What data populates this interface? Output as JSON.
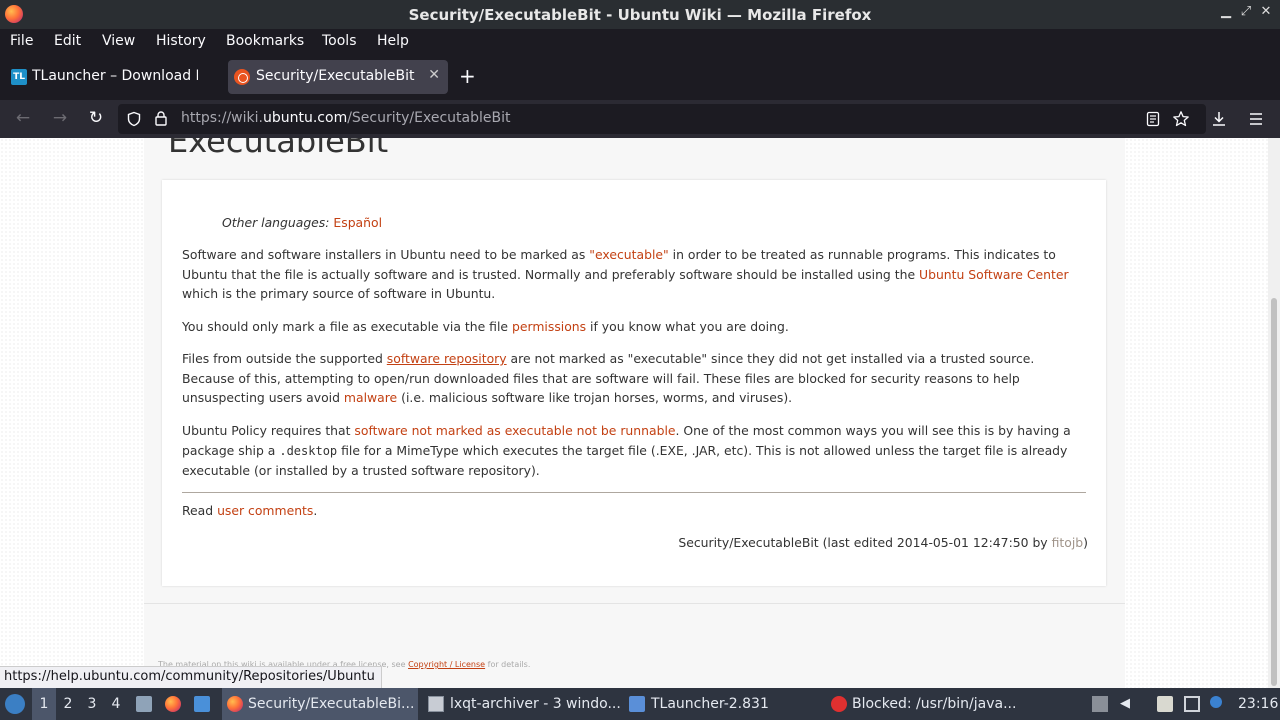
{
  "window": {
    "title": "Security/ExecutableBit - Ubuntu Wiki — Mozilla Firefox",
    "min": "▁",
    "max": "⤢",
    "close": "✕"
  },
  "menu": [
    "File",
    "Edit",
    "View",
    "History",
    "Bookmarks",
    "Tools",
    "Help"
  ],
  "tabs": [
    {
      "label": "TLauncher – Download M",
      "favicon": "TL"
    },
    {
      "label": "Security/ExecutableBit - U",
      "close": "✕"
    }
  ],
  "newtab": "+",
  "nav": {
    "back": "←",
    "forward": "→",
    "reload": "↻",
    "url_prefix": "https://wiki.",
    "url_host": "ubuntu.com",
    "url_path": "/Security/ExecutableBit"
  },
  "page": {
    "heading": "ExecutableBit",
    "other_languages_label": "Other languages:",
    "other_languages_link": "Español",
    "p1": {
      "t1": "Software and software installers in Ubuntu need to be marked as ",
      "l1": "\"executable\"",
      "t2": " in order to be treated as runnable programs. This indicates to Ubuntu that the file is actually software and is trusted. Normally and preferably software should be installed using the ",
      "l2": "Ubuntu Software Center",
      "t3": " which is the primary source of software in Ubuntu."
    },
    "p2": {
      "t1": "You should only mark a file as executable via the file ",
      "l1": "permissions",
      "t2": " if you know what you are doing."
    },
    "p3": {
      "t1": "Files from outside the supported ",
      "l1": "software repository",
      "t2": " are not marked as \"executable\" since they did not get installed via a trusted source. Because of this, attempting to open/run downloaded files that are software will fail. These files are blocked for security reasons to help unsuspecting users avoid ",
      "l2": "malware",
      "t3": " (i.e. malicious software like trojan horses, worms, and viruses)."
    },
    "p4": {
      "t1": "Ubuntu Policy requires that ",
      "l1": "software not marked as executable not be runnable",
      "t2": ". One of the most common ways you will see this is by having a package ship a ",
      "code": ".desktop",
      "t3": " file for a MimeType which executes the target file (.EXE, .JAR, etc). This is not allowed unless the target file is already executable (or installed by a trusted software repository)."
    },
    "read": {
      "t1": "Read ",
      "l1": "user comments",
      "t2": "."
    },
    "last_edited": {
      "t1": "Security/ExecutableBit (last edited 2014-05-01 12:47:50 by ",
      "l1": "fitojb",
      "t2": ")"
    },
    "footer": {
      "t1": "The material on this wiki is available under a free license, see ",
      "l1": "Copyright / License",
      "t2": " for details."
    }
  },
  "status_link": "https://help.ubuntu.com/community/Repositories/Ubuntu",
  "taskbar": {
    "desktops": [
      "1",
      "2",
      "3",
      "4"
    ],
    "windows": [
      {
        "label": "Security/ExecutableBi..."
      },
      {
        "label": "lxqt-archiver - 3 windo..."
      },
      {
        "label": "TLauncher-2.831"
      },
      {
        "label": "Blocked: /usr/bin/java..."
      }
    ],
    "clock": "23:16"
  },
  "colors": {
    "link": "#c34113",
    "taskbar": "#2e3440",
    "chrome": "#1c1b22"
  }
}
